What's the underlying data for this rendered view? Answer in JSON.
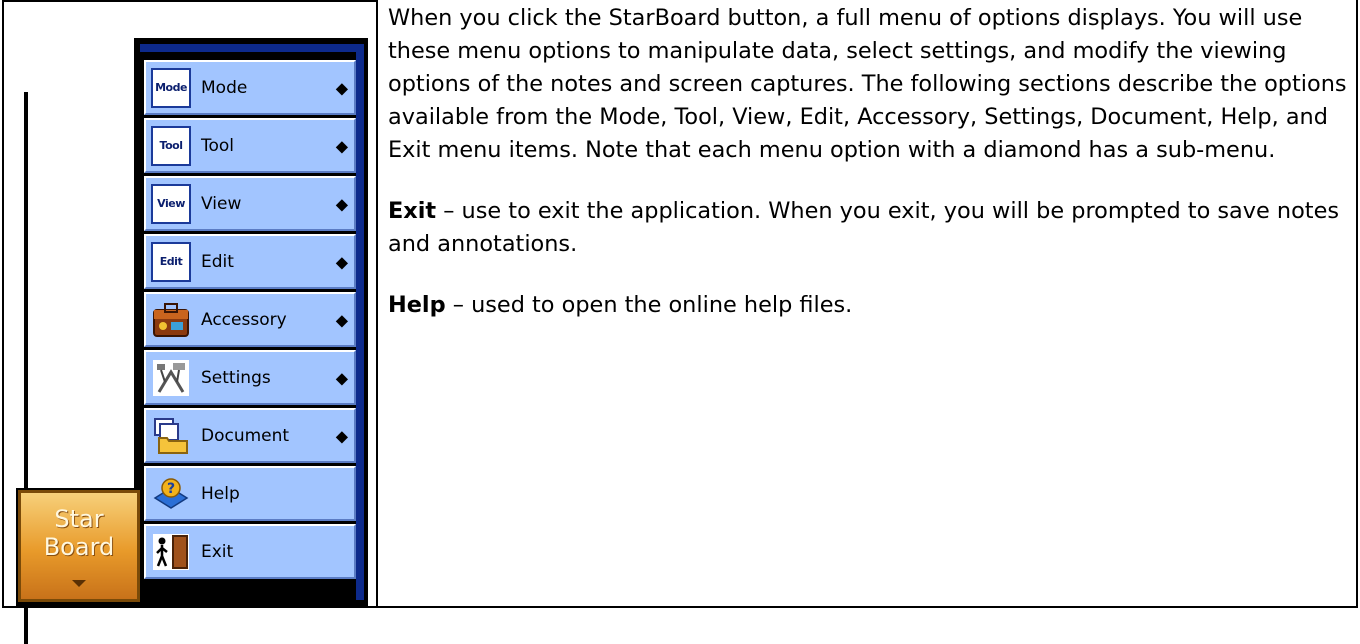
{
  "menu": {
    "items": [
      {
        "icon_text": "Mode",
        "label": "Mode",
        "submenu_marker": "◆"
      },
      {
        "icon_text": "Tool",
        "label": "Tool",
        "submenu_marker": "◆"
      },
      {
        "icon_text": "View",
        "label": "View",
        "submenu_marker": "◆"
      },
      {
        "icon_text": "Edit",
        "label": "Edit",
        "submenu_marker": "◆"
      },
      {
        "icon": "accessory-icon",
        "label": "Accessory",
        "submenu_marker": "◆"
      },
      {
        "icon": "settings-icon",
        "label": "Settings",
        "submenu_marker": "◆"
      },
      {
        "icon": "document-icon",
        "label": "Document",
        "submenu_marker": "◆"
      },
      {
        "icon": "help-icon",
        "label": "Help"
      },
      {
        "icon": "exit-icon",
        "label": "Exit"
      }
    ]
  },
  "starboard_button": {
    "line1": "Star",
    "line2": "Board"
  },
  "description": {
    "intro": "When you click the StarBoard button, a full menu of options displays.  You will use these menu options to manipulate data, select settings, and modify the viewing options of the notes and screen captures.  The following sections describe the options available from the Mode, Tool, View, Edit, Accessory, Settings, Document, Help, and Exit menu items.  Note that each menu option with a diamond has a sub-menu.",
    "exit_term": "Exit",
    "exit_text": " – use to exit the application.  When you exit, you will be prompted to save notes and annotations.",
    "help_term": "Help",
    "help_text": " – used to open the online help files."
  },
  "colors": {
    "menu_item_bg": "#a2c5ff",
    "panel_blue": "#0d2a8c",
    "starboard_orange": "#e89a2a"
  }
}
